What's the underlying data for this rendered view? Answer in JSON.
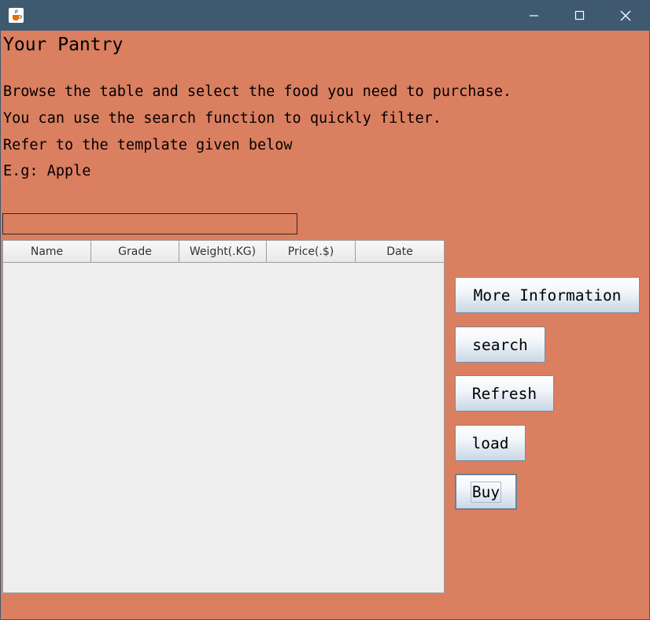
{
  "window": {
    "controls": {
      "minimize_icon": "minimize-icon",
      "maximize_icon": "maximize-icon",
      "close_icon": "close-icon"
    },
    "app_icon": "java-cup-icon"
  },
  "header": {
    "title": "Your Pantry",
    "instructions": [
      "Browse the table and select the food you need to purchase.",
      "You can use the search function to quickly filter.",
      "Refer to the template given below",
      "E.g: Apple"
    ]
  },
  "search": {
    "value": "",
    "placeholder": ""
  },
  "table": {
    "columns": [
      "Name",
      "Grade",
      "Weight(.KG)",
      "Price(.$)",
      "Date"
    ],
    "rows": []
  },
  "buttons": {
    "more_info": "More Information",
    "search": "search",
    "refresh": "Refresh",
    "load": "load",
    "buy": "Buy"
  },
  "colors": {
    "background": "#db7f61",
    "titlebar": "#3f5a70",
    "table_background": "#eeeeee"
  }
}
